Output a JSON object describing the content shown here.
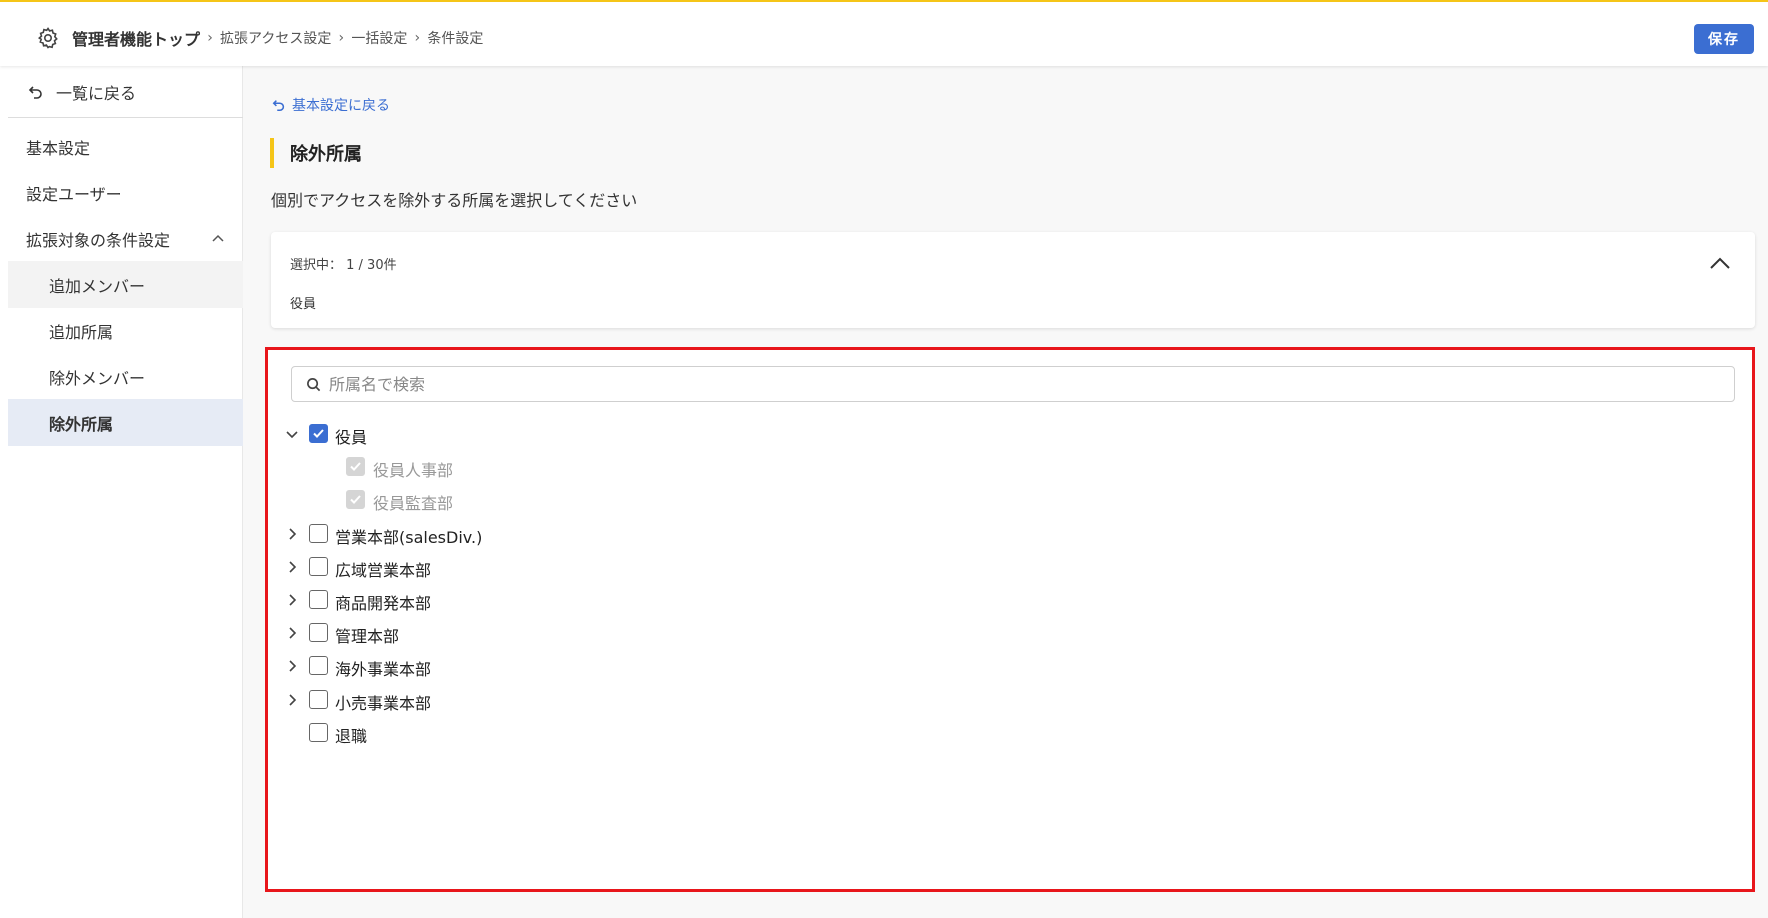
{
  "header": {
    "home_label": "管理者機能トップ",
    "crumbs": [
      "拡張アクセス設定",
      "一括設定",
      "条件設定"
    ],
    "save_label": "保存"
  },
  "sidebar": {
    "back_label": "一覧に戻る",
    "items": [
      {
        "label": "基本設定"
      },
      {
        "label": "設定ユーザー"
      },
      {
        "label": "拡張対象の条件設定"
      },
      {
        "label": "追加メンバー"
      },
      {
        "label": "追加所属"
      },
      {
        "label": "除外メンバー"
      },
      {
        "label": "除外所属"
      }
    ]
  },
  "main": {
    "back_link": "基本設定に戻る",
    "section_title": "除外所属",
    "description": "個別でアクセスを除外する所属を選択してください",
    "selection": {
      "count_label": "選択中： 1 / 30件",
      "selected_tag": "役員"
    },
    "search": {
      "placeholder": "所属名で検索"
    },
    "tree": [
      {
        "label": "役員",
        "state": "checked",
        "expander": "expanded"
      },
      {
        "label": "役員人事部",
        "state": "disabled-checked",
        "expander": "none"
      },
      {
        "label": "役員監査部",
        "state": "disabled-checked",
        "expander": "none"
      },
      {
        "label": "営業本部(salesDiv.)",
        "state": "unchecked",
        "expander": "collapsed"
      },
      {
        "label": "広域営業本部",
        "state": "unchecked",
        "expander": "collapsed"
      },
      {
        "label": "商品開発本部",
        "state": "unchecked",
        "expander": "collapsed"
      },
      {
        "label": "管理本部",
        "state": "unchecked",
        "expander": "collapsed"
      },
      {
        "label": "海外事業本部",
        "state": "unchecked",
        "expander": "collapsed"
      },
      {
        "label": "小売事業本部",
        "state": "unchecked",
        "expander": "collapsed"
      },
      {
        "label": "退職",
        "state": "unchecked",
        "expander": "none"
      }
    ]
  },
  "colors": {
    "accent": "#3b6ed2",
    "highlight": "#f5c518",
    "annotation": "#e8161b",
    "active_bg": "#e6ebf5"
  }
}
